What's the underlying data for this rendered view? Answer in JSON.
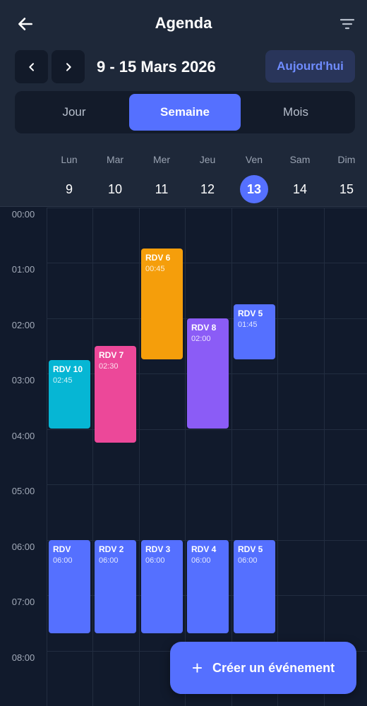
{
  "header": {
    "title": "Agenda",
    "back_icon": "arrow-left-icon",
    "filter_icon": "filter-icon"
  },
  "range": {
    "label": "9 - 15 Mars 2026",
    "prev_icon": "chevron-left-icon",
    "next_icon": "chevron-right-icon",
    "today_label": "Aujourd'hui"
  },
  "view_modes": [
    {
      "label": "Jour",
      "active": false
    },
    {
      "label": "Semaine",
      "active": true
    },
    {
      "label": "Mois",
      "active": false
    }
  ],
  "days": [
    {
      "name": "Lun",
      "num": "9"
    },
    {
      "name": "Mar",
      "num": "10"
    },
    {
      "name": "Mer",
      "num": "11"
    },
    {
      "name": "Jeu",
      "num": "12"
    },
    {
      "name": "Ven",
      "num": "13",
      "current": true
    },
    {
      "name": "Sam",
      "num": "14"
    },
    {
      "name": "Dim",
      "num": "15"
    }
  ],
  "hours": [
    "00:00",
    "01:00",
    "02:00",
    "03:00",
    "04:00",
    "05:00",
    "06:00",
    "07:00",
    "08:00"
  ],
  "events": [
    {
      "title": "RDV 10",
      "time": "02:45",
      "day": 0,
      "color": "#06b6d4"
    },
    {
      "title": "RDV 7",
      "time": "02:30",
      "day": 1,
      "color": "#ec4899"
    },
    {
      "title": "RDV 6",
      "time": "00:45",
      "day": 2,
      "color": "#f59e0b"
    },
    {
      "title": "RDV 8",
      "time": "02:00",
      "day": 3,
      "color": "#8b5cf6"
    },
    {
      "title": "RDV 5",
      "time": "01:45",
      "day": 4,
      "color": "#5570ff"
    },
    {
      "title": "RDV",
      "time": "06:00",
      "day": 0,
      "color": "#5570ff"
    },
    {
      "title": "RDV 2",
      "time": "06:00",
      "day": 1,
      "color": "#5570ff"
    },
    {
      "title": "RDV 3",
      "time": "06:00",
      "day": 2,
      "color": "#5570ff"
    },
    {
      "title": "RDV 4",
      "time": "06:00",
      "day": 3,
      "color": "#5570ff"
    },
    {
      "title": "RDV 5",
      "time": "06:00",
      "day": 4,
      "color": "#5570ff"
    }
  ],
  "fab": {
    "label": "Créer un événement",
    "icon": "plus-icon"
  },
  "colors": {
    "accent": "#5570ff",
    "background": "#111a2c",
    "header": "#1e2839"
  }
}
